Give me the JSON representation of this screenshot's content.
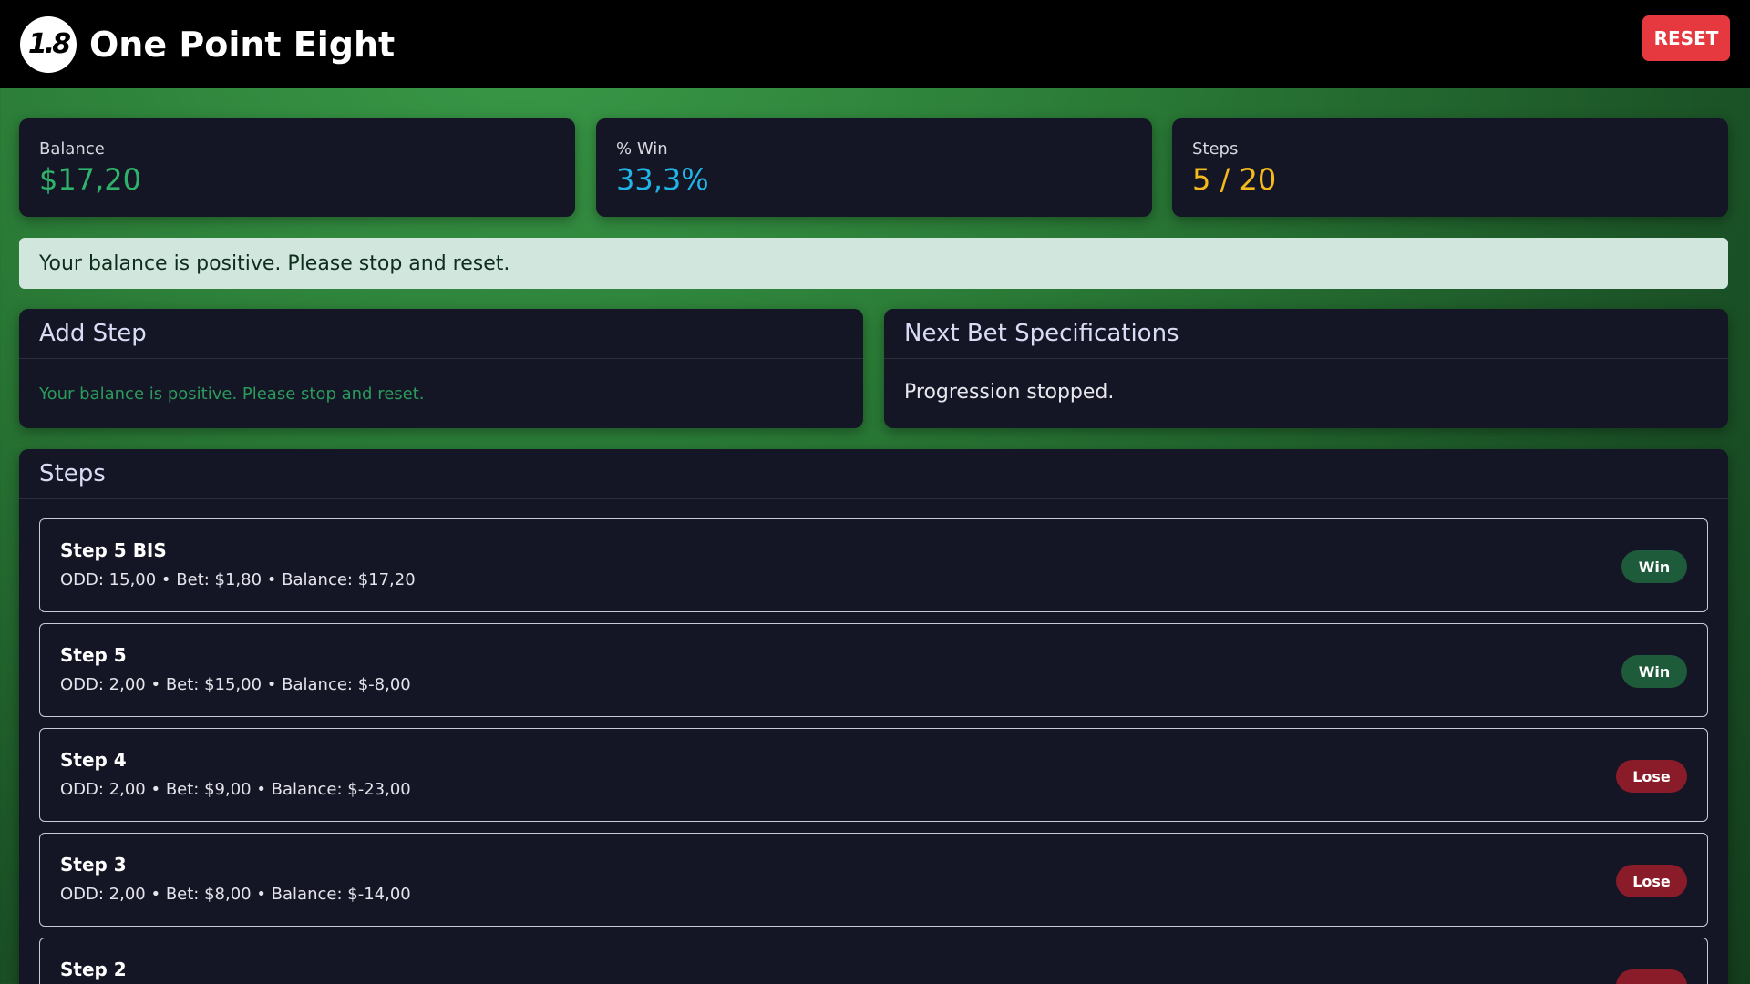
{
  "header": {
    "logo_text": "1.8",
    "app_title": "One Point Eight",
    "reset_label": "RESET"
  },
  "stats": {
    "balance": {
      "label": "Balance",
      "value": "$17,20"
    },
    "win_pct": {
      "label": "% Win",
      "value": "33,3%"
    },
    "steps": {
      "label": "Steps",
      "value": "5 / 20"
    }
  },
  "alert": {
    "text": "Your balance is positive. Please stop and reset."
  },
  "add_step": {
    "title": "Add Step",
    "message": "Your balance is positive. Please stop and reset."
  },
  "next_bet": {
    "title": "Next Bet Specifications",
    "message": "Progression stopped."
  },
  "steps_panel": {
    "title": "Steps",
    "items": [
      {
        "title": "Step 5 BIS",
        "meta": "ODD: 15,00 • Bet: $1,80 • Balance: $17,20",
        "result": "Win"
      },
      {
        "title": "Step 5",
        "meta": "ODD: 2,00 • Bet: $15,00 • Balance: $-8,00",
        "result": "Win"
      },
      {
        "title": "Step 4",
        "meta": "ODD: 2,00 • Bet: $9,00 • Balance: $-23,00",
        "result": "Lose"
      },
      {
        "title": "Step 3",
        "meta": "ODD: 2,00 • Bet: $8,00 • Balance: $-14,00",
        "result": "Lose"
      },
      {
        "title": "Step 2",
        "meta": "",
        "result": ""
      }
    ]
  },
  "colors": {
    "balance_value": "#2fb36a",
    "win_value": "#21b4e8",
    "steps_value": "#f5b91c",
    "reset_button": "#e5393f",
    "win_badge": "#1e5b3b",
    "lose_badge": "#8a1b28"
  }
}
